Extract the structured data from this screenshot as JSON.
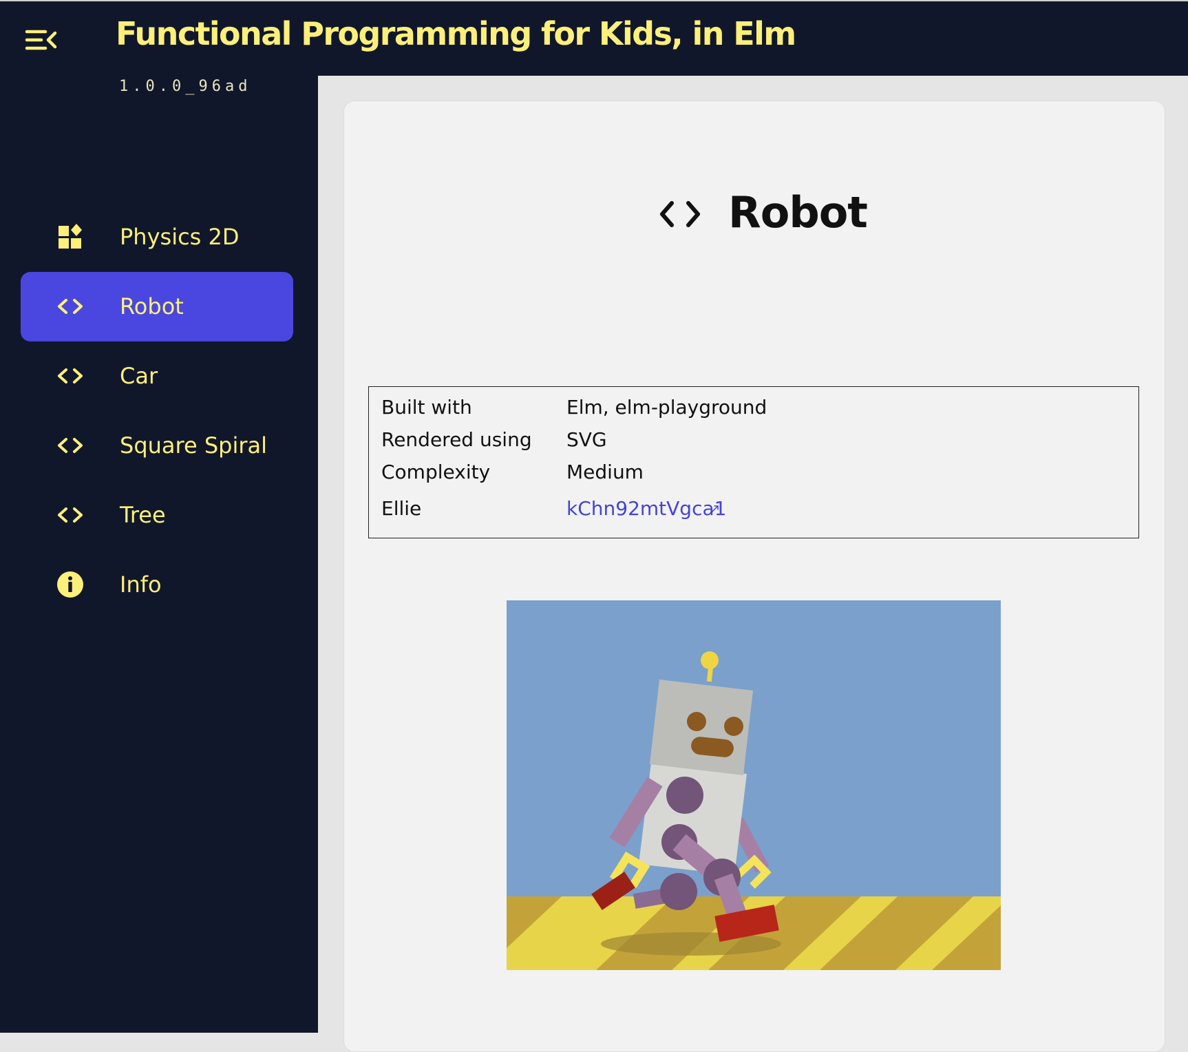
{
  "header": {
    "title": "Functional Programming for Kids, in Elm",
    "menu_icon": "menu-collapse-icon"
  },
  "sidebar": {
    "version": "1.0.0_96ad",
    "items": [
      {
        "label": "Physics 2D",
        "icon": "widgets-icon",
        "active": false
      },
      {
        "label": "Robot",
        "icon": "code-icon",
        "active": true
      },
      {
        "label": "Car",
        "icon": "code-icon",
        "active": false
      },
      {
        "label": "Square Spiral",
        "icon": "code-icon",
        "active": false
      },
      {
        "label": "Tree",
        "icon": "code-icon",
        "active": false
      },
      {
        "label": "Info",
        "icon": "info-icon",
        "active": false
      }
    ]
  },
  "page": {
    "title": "Robot",
    "title_icon": "code-icon",
    "details": [
      {
        "key": "Built with",
        "value": "Elm, elm-playground"
      },
      {
        "key": "Rendered using",
        "value": "SVG"
      },
      {
        "key": "Complexity",
        "value": "Medium"
      },
      {
        "key": "Ellie",
        "value": "kChn92mtVgca1",
        "link": true
      }
    ]
  },
  "colors": {
    "background_dark": "#11172b",
    "accent_yellow": "#fdf07a",
    "active_item": "#4a47e0",
    "link": "#4542d6",
    "card": "#f2f2f2"
  }
}
